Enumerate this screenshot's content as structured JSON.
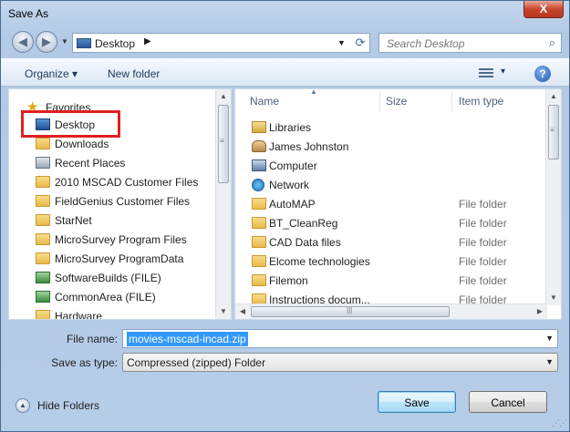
{
  "window": {
    "title": "Save As",
    "close_label": "X"
  },
  "address": {
    "location": "Desktop",
    "arrow": "▶"
  },
  "search": {
    "placeholder": "Search Desktop"
  },
  "toolbar": {
    "organize": "Organize ▾",
    "new_folder": "New folder",
    "view_dropdown": "▾",
    "help": "?"
  },
  "nav_pane": {
    "favorites_label": "Favorites",
    "items": [
      {
        "label": "Desktop",
        "icon": "desktop-icon"
      },
      {
        "label": "Downloads",
        "icon": "downloads-folder-icon"
      },
      {
        "label": "Recent Places",
        "icon": "recent-places-icon"
      },
      {
        "label": "2010 MSCAD Customer Files",
        "icon": "folder-icon"
      },
      {
        "label": "FieldGenius Customer Files",
        "icon": "folder-icon"
      },
      {
        "label": "StarNet",
        "icon": "folder-icon"
      },
      {
        "label": "MicroSurvey Program Files",
        "icon": "folder-icon"
      },
      {
        "label": "MicroSurvey ProgramData",
        "icon": "folder-icon"
      },
      {
        "label": "SoftwareBuilds (FILE)",
        "icon": "network-drive-icon"
      },
      {
        "label": "CommonArea (FILE)",
        "icon": "network-drive-icon"
      },
      {
        "label": "Hardware",
        "icon": "folder-icon"
      }
    ]
  },
  "file_pane": {
    "columns": {
      "name": "Name",
      "size": "Size",
      "type": "Item type"
    },
    "rows": [
      {
        "name": "Libraries",
        "type": "",
        "icon": "libraries-icon"
      },
      {
        "name": "James Johnston",
        "type": "",
        "icon": "user-folder-icon"
      },
      {
        "name": "Computer",
        "type": "",
        "icon": "computer-icon"
      },
      {
        "name": "Network",
        "type": "",
        "icon": "network-icon"
      },
      {
        "name": "AutoMAP",
        "type": "File folder",
        "icon": "folder-icon"
      },
      {
        "name": "BT_CleanReg",
        "type": "File folder",
        "icon": "folder-icon"
      },
      {
        "name": "CAD Data files",
        "type": "File folder",
        "icon": "folder-icon"
      },
      {
        "name": "Elcome technologies",
        "type": "File folder",
        "icon": "folder-icon"
      },
      {
        "name": "Filemon",
        "type": "File folder",
        "icon": "folder-icon"
      },
      {
        "name": "Instructions docum...",
        "type": "File folder",
        "icon": "folder-icon"
      }
    ]
  },
  "form": {
    "file_name_label": "File name:",
    "file_name_value": "movies-mscad-incad.zip",
    "save_as_type_label": "Save as type:",
    "save_as_type_value": "Compressed (zipped) Folder"
  },
  "footer": {
    "hide_folders": "Hide Folders",
    "save": "Save",
    "cancel": "Cancel"
  },
  "colors": {
    "highlight_box": "#e02020",
    "selection": "#3399ff",
    "close_button": "#c9452c"
  }
}
